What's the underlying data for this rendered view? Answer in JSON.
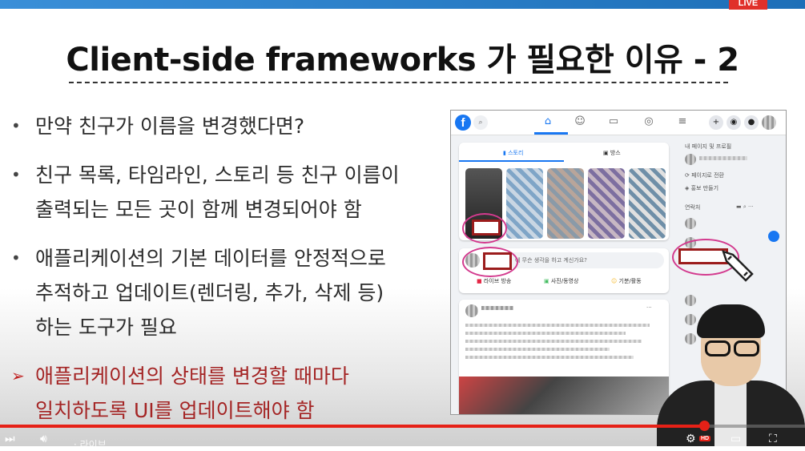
{
  "video": {
    "live_badge": "LIVE",
    "progress_fraction": 0.875,
    "controls": {
      "play_icon": "skip-next-icon",
      "volume_icon": "volume-icon",
      "chapter_label": "· 라이브",
      "settings_icon": "gear-icon",
      "hd_badge": "HD",
      "miniplayer_icon": "miniplayer-icon",
      "fullscreen_icon": "fullscreen-icon"
    },
    "accent_color": "#e62117"
  },
  "slide": {
    "title": "Client-side frameworks 가 필요한 이유 - 2",
    "bullets": [
      {
        "marker": "•",
        "lines": [
          "만약 친구가 이름을 변경했다면?"
        ]
      },
      {
        "marker": "•",
        "lines": [
          "친구 목록, 타임라인, 스토리 등 친구 이름이",
          "출력되는 모든 곳이 함께 변경되어야 함"
        ]
      },
      {
        "marker": "•",
        "lines": [
          "애플리케이션의 기본 데이터를 안정적으로",
          "추적하고 업데이트(렌더링, 추가, 삭제 등)",
          "하는 도구가 필요"
        ]
      },
      {
        "marker": "➢",
        "lines": [
          "애플리케이션의 상태를 변경할 때마다",
          "일치하도록 UI를 업데이트해야 함"
        ],
        "highlight": true
      }
    ],
    "highlight_color": "#a42424"
  },
  "facebook_screenshot": {
    "logo": "f",
    "stories_tab": "스토리",
    "rooms_tab": "방스",
    "composer_placeholder": "에 무슨 생각을 하고 계신가요?",
    "action_live": "라이브 방송",
    "action_photo": "사진/동영상",
    "action_feeling": "기분/활동",
    "right_pages_title": "내 페이지 및 프로필",
    "right_item_1": "페이지로 전환",
    "right_item_2": "홍보 만들기",
    "right_contacts_title": "연락처",
    "brand_color": "#1877f2"
  }
}
